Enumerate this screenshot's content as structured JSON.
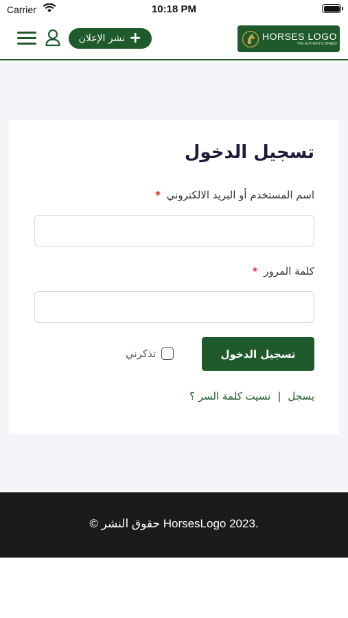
{
  "status_bar": {
    "carrier": "Carrier",
    "time": "10:18 PM",
    "wifi_icon": "wifi-icon",
    "battery_icon": "battery-icon"
  },
  "header": {
    "menu_icon": "hamburger-menu-icon",
    "user_icon": "user-icon",
    "post_ad_label": "نشر الإعلان",
    "post_ad_icon": "+",
    "logo": {
      "main": "HORSES LOGO",
      "sub": "THE AUTHENTIC BREED",
      "icon": "horse-head-icon"
    }
  },
  "login": {
    "title": "تسجيل الدخول",
    "username_label": "اسم المستخدم أو البريد الالكتروني",
    "username_value": "",
    "password_label": "كلمة المرور",
    "password_value": "",
    "required_mark": "*",
    "submit_label": "تسجيل الدخول",
    "remember_label": "تذكرني",
    "remember_checked": false,
    "register_link": "يسجل",
    "separator": "|",
    "forgot_link": "نسيت كلمة السر ؟"
  },
  "footer": {
    "copyright": "© حقوق النشر HorsesLogo 2023."
  },
  "colors": {
    "brand_green": "#1e5a2c",
    "background": "#f3f5f9",
    "footer_bg": "#1b1b1b",
    "required": "#e02020"
  }
}
